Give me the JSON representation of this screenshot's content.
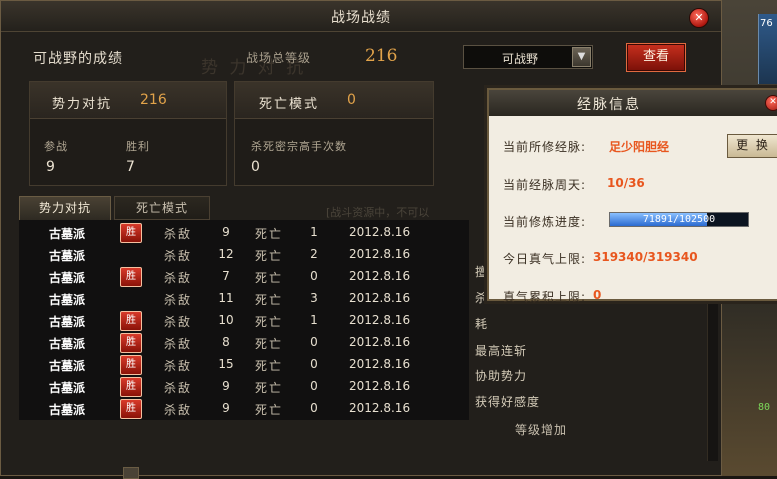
{
  "window": {
    "title": "战场战绩",
    "close": "✕",
    "side_tab_char": "口"
  },
  "header": {
    "label": "可战野的成绩",
    "watermark": "势 力 对 抗",
    "level_label": "战场总等级",
    "level_value": "216",
    "select_value": "可战野",
    "check_button": "查看"
  },
  "panels": {
    "faction": {
      "title": "势力对抗",
      "value": "216",
      "stat1_label": "参战",
      "stat1_value": "9",
      "stat2_label": "胜利",
      "stat2_value": "7"
    },
    "death": {
      "title": "死亡模式",
      "value": "0",
      "stat_label": "杀死密宗高手次数",
      "stat_value": "0"
    }
  },
  "tabs": [
    "势力对抗",
    "死亡模式"
  ],
  "list_tip": "[战斗资源中，不可以",
  "records": [
    {
      "faction": "古墓派",
      "win": true,
      "kill_label": "杀敌",
      "kills": "9",
      "death_label": "死亡",
      "deaths": "1",
      "date": "2012.8.16"
    },
    {
      "faction": "古墓派",
      "win": false,
      "kill_label": "杀敌",
      "kills": "12",
      "death_label": "死亡",
      "deaths": "2",
      "date": "2012.8.16"
    },
    {
      "faction": "古墓派",
      "win": true,
      "kill_label": "杀敌",
      "kills": "7",
      "death_label": "死亡",
      "deaths": "0",
      "date": "2012.8.16"
    },
    {
      "faction": "古墓派",
      "win": false,
      "kill_label": "杀敌",
      "kills": "11",
      "death_label": "死亡",
      "deaths": "3",
      "date": "2012.8.16"
    },
    {
      "faction": "古墓派",
      "win": true,
      "kill_label": "杀敌",
      "kills": "10",
      "death_label": "死亡",
      "deaths": "1",
      "date": "2012.8.16"
    },
    {
      "faction": "古墓派",
      "win": true,
      "kill_label": "杀敌",
      "kills": "8",
      "death_label": "死亡",
      "deaths": "0",
      "date": "2012.8.16"
    },
    {
      "faction": "古墓派",
      "win": true,
      "kill_label": "杀敌",
      "kills": "15",
      "death_label": "死亡",
      "deaths": "0",
      "date": "2012.8.16"
    },
    {
      "faction": "古墓派",
      "win": true,
      "kill_label": "杀敌",
      "kills": "9",
      "death_label": "死亡",
      "deaths": "0",
      "date": "2012.8.16"
    },
    {
      "faction": "古墓派",
      "win": true,
      "kill_label": "杀敌",
      "kills": "9",
      "death_label": "死亡",
      "deaths": "0",
      "date": "2012.8.16"
    }
  ],
  "badge_text": "胜",
  "right_col": {
    "item1": "擅",
    "item2": "杀",
    "item3": "耗",
    "item4": "最高连斩",
    "item5": "协助势力",
    "item6": "获得好感度",
    "bottom": "等级增加"
  },
  "popup": {
    "title": "经脉信息",
    "close": "✕",
    "meridian_label": "当前所修经脉:",
    "meridian_value": "足少阳胆经",
    "swap_button": "更 换",
    "cycle_label": "当前经脉周天:",
    "cycle_value": "10/36",
    "progress_label": "当前修炼进度:",
    "progress_text": "71891/102500",
    "progress_fraction": 0.7014,
    "daily_label": "今日真气上限:",
    "daily_value": "319340/319340",
    "accum_label": "真气累积上限:",
    "accum_value": "0"
  },
  "scene": {
    "blue_num": "76",
    "green_text": "80"
  }
}
